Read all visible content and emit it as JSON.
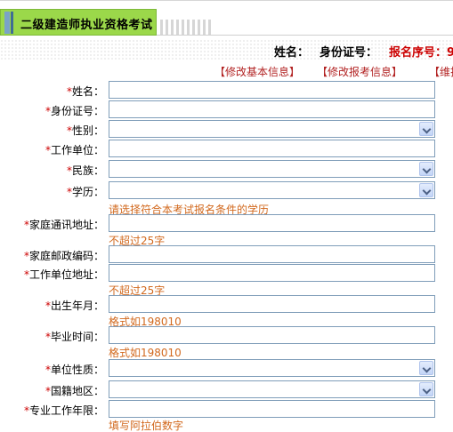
{
  "header": {
    "title": "二级建造师执业资格考试"
  },
  "info": {
    "name_label": "姓名：",
    "id_label": "身份证号：",
    "reg_label": "报名序号：9"
  },
  "links": [
    "【修改基本信息】",
    "【修改报考信息】",
    "【维护"
  ],
  "form": {
    "name": "姓名：",
    "id_number": "身份证号：",
    "gender": "性别：",
    "employer": "工作单位：",
    "ethnicity": "民族：",
    "education": "学历：",
    "education_hint": "请选择符合本考试报名条件的学历",
    "home_address": "家庭通讯地址：",
    "home_address_hint": "不超过25字",
    "postal_code": "家庭邮政编码：",
    "employer_address": "工作单位地址：",
    "employer_address_hint": "不超过25字",
    "birth_date": "出生年月：",
    "birth_date_hint": "格式如198010",
    "graduation_date": "毕业时间：",
    "graduation_date_hint": "格式如198010",
    "employer_type": "单位性质：",
    "nationality": "国籍地区：",
    "work_years": "专业工作年限：",
    "work_years_hint": "填写阿拉伯数字",
    "required_mark": "*"
  },
  "colors": {
    "tab_green": "#9bd84a",
    "required_red": "#cc0000",
    "hint_orange": "#d2691e",
    "link_red": "#b22222"
  }
}
